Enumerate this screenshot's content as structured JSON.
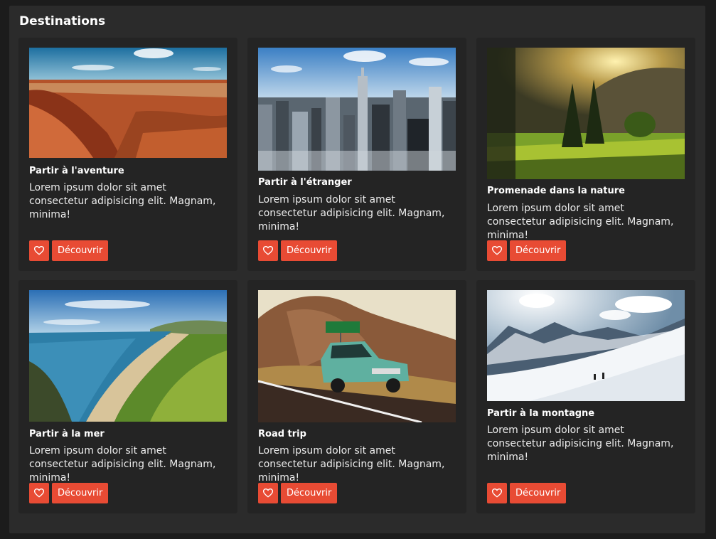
{
  "section": {
    "title": "Destinations"
  },
  "accent_color": "#e84b34",
  "cards": [
    {
      "title": "Partir à l'aventure",
      "description": "Lorem ipsum dolor sit amet consectetur adipisicing elit. Magnam, minima!",
      "button": "Découvrir",
      "icon": "heart-icon",
      "image": "red-canyon-landscape"
    },
    {
      "title": "Partir à l'étranger",
      "description": "Lorem ipsum dolor sit amet consectetur adipisicing elit. Magnam, minima!",
      "button": "Découvrir",
      "icon": "heart-icon",
      "image": "city-skyline"
    },
    {
      "title": "Promenade dans la nature",
      "description": "Lorem ipsum dolor sit amet consectetur adipisicing elit. Magnam, minima!",
      "button": "Découvrir",
      "icon": "heart-icon",
      "image": "forest-meadow-sunset"
    },
    {
      "title": "Partir à la mer",
      "description": "Lorem ipsum dolor sit amet consectetur adipisicing elit. Magnam, minima!",
      "button": "Découvrir",
      "icon": "heart-icon",
      "image": "coastline-beach-cliffs"
    },
    {
      "title": "Road trip",
      "description": "Lorem ipsum dolor sit amet consectetur adipisicing elit. Magnam, minima!",
      "button": "Découvrir",
      "icon": "heart-icon",
      "image": "vintage-car-on-road"
    },
    {
      "title": "Partir à la montagne",
      "description": "Lorem ipsum dolor sit amet consectetur adipisicing elit. Magnam, minima!",
      "button": "Découvrir",
      "icon": "heart-icon",
      "image": "snowy-mountains-hikers"
    }
  ]
}
